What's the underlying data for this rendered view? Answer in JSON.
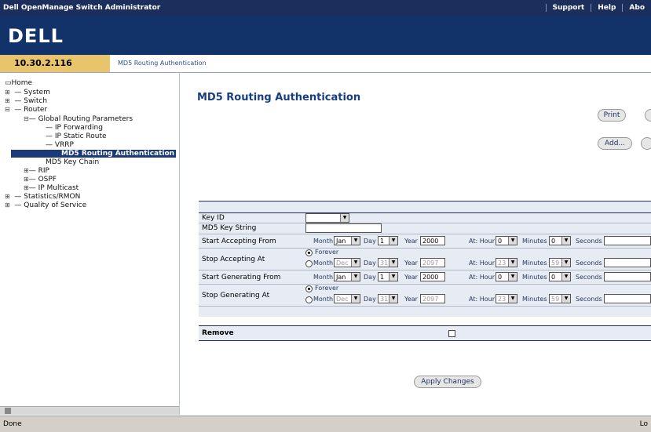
{
  "app": {
    "title": "Dell OpenManage Switch Administrator",
    "links": [
      "Support",
      "Help",
      "Abo"
    ],
    "logo": "DELL"
  },
  "address": {
    "ip": "10.30.2.116",
    "breadcrumb": "MD5 Routing Authentication"
  },
  "tree": {
    "home": "Home",
    "system": "System",
    "switch": "Switch",
    "router": "Router",
    "global_routing": "Global Routing Parameters",
    "ip_forwarding": "IP Forwarding",
    "ip_static_route": "IP Static Route",
    "vrrp": "VRRP",
    "md5_auth": "MD5 Routing Authentication",
    "md5_key_chain": "MD5 Key Chain",
    "rip": "RIP",
    "ospf": "OSPF",
    "ip_multicast": "IP Multicast",
    "statistics": "Statistics/RMON",
    "qos": "Quality of Service"
  },
  "main": {
    "title": "MD5 Routing Authentication",
    "print_label": "Print",
    "add_label": "Add...",
    "apply_label": "Apply Changes"
  },
  "form": {
    "key_id_label": "Key ID",
    "key_id_value": "",
    "key_string_label": "MD5 Key String",
    "key_string_value": "",
    "start_accepting_label": "Start Accepting From",
    "stop_accepting_label": "Stop Accepting At",
    "start_generating_label": "Start Generating From",
    "stop_generating_label": "Stop Generating At",
    "forever_label": "Forever",
    "month_label": "Month",
    "day_label": "Day",
    "year_label": "Year",
    "at_hour_label": "At: Hour",
    "minutes_label": "Minutes",
    "seconds_label": "Seconds",
    "start_accept": {
      "month": "Jan",
      "day": "1",
      "year": "2000",
      "hour": "0",
      "minutes": "0"
    },
    "stop_accept": {
      "month": "Dec",
      "day": "31",
      "year": "2097",
      "hour": "23",
      "minutes": "59"
    },
    "start_gen": {
      "month": "Jan",
      "day": "1",
      "year": "2000",
      "hour": "0",
      "minutes": "0"
    },
    "stop_gen": {
      "month": "Dec",
      "day": "31",
      "year": "2097",
      "hour": "23",
      "minutes": "59"
    },
    "remove_label": "Remove"
  },
  "status": {
    "left": "Done",
    "right": "Lo"
  }
}
